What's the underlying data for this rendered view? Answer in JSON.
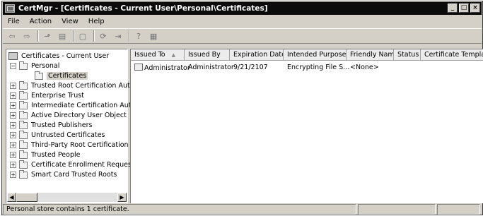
{
  "window": {
    "title": "CertMgr - [Certificates - Current User\\Personal\\Certificates]",
    "controls": [
      "_",
      "□",
      "×"
    ]
  },
  "menu": [
    "File",
    "Action",
    "View",
    "Help"
  ],
  "toolbar": {
    "buttons": [
      "back-icon",
      "forward-icon",
      "up-folder-icon",
      "show-tree-icon",
      "copy-icon",
      "refresh-icon",
      "export-icon",
      "help-icon",
      "properties-icon"
    ]
  },
  "tree": {
    "root": "Certificates - Current User",
    "items": [
      {
        "label": "Personal",
        "expander": "−"
      },
      {
        "label": "Certificates",
        "expander": ""
      },
      {
        "label": "Trusted Root Certification Autl",
        "expander": "+"
      },
      {
        "label": "Enterprise Trust",
        "expander": "+"
      },
      {
        "label": "Intermediate Certification Autl",
        "expander": "+"
      },
      {
        "label": "Active Directory User Object",
        "expander": "+"
      },
      {
        "label": "Trusted Publishers",
        "expander": "+"
      },
      {
        "label": "Untrusted Certificates",
        "expander": "+"
      },
      {
        "label": "Third-Party Root Certification /",
        "expander": "+"
      },
      {
        "label": "Trusted People",
        "expander": "+"
      },
      {
        "label": "Certificate Enrollment Request",
        "expander": "+"
      },
      {
        "label": "Smart Card Trusted Roots",
        "expander": "+"
      }
    ]
  },
  "list": {
    "columns": [
      "Issued To",
      "Issued By",
      "Expiration Date",
      "Intended Purposes",
      "Friendly Name",
      "Status",
      "Certificate Template"
    ],
    "sort_indicator": "▲",
    "rows": [
      {
        "issued_to": "Administrator",
        "issued_by": "Administrator",
        "expiration": "9/21/2107",
        "purposes": "Encrypting File S...",
        "friendly": "<None>",
        "status": "",
        "template": ""
      }
    ]
  },
  "statusbar": {
    "text": "Personal store contains 1 certificate."
  }
}
